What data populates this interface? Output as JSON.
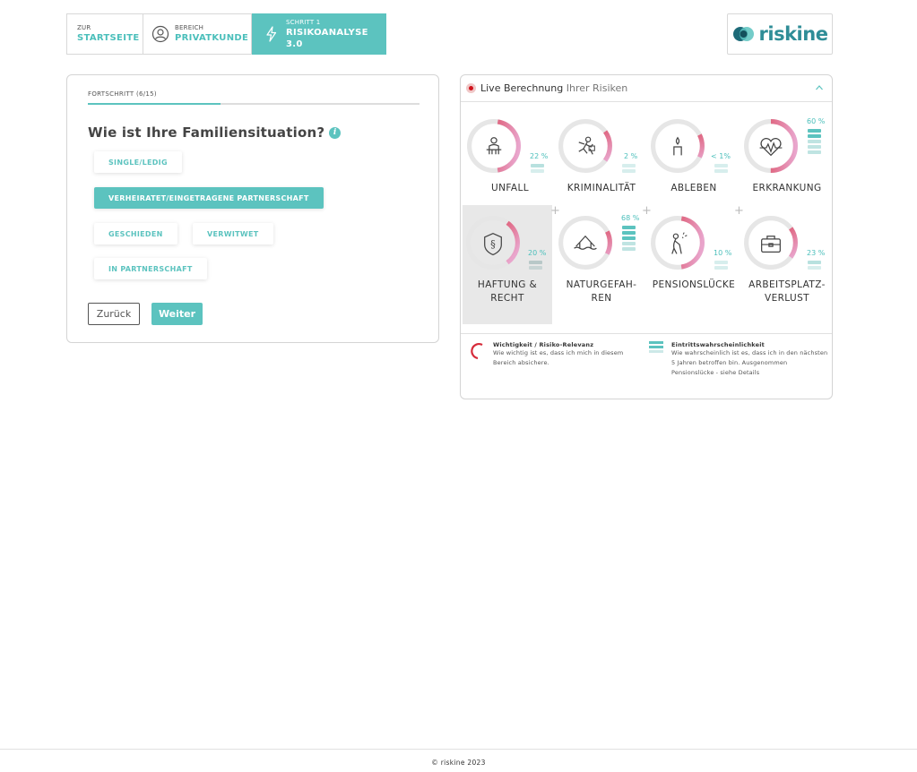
{
  "nav": {
    "start": {
      "small": "ZUR",
      "big": "STARTSEITE"
    },
    "bereich": {
      "small": "BEREICH",
      "big": "PRIVATKUNDE",
      "icon": "user-circle-icon"
    },
    "schritt": {
      "small": "SCHRITT 1",
      "big": "RISIKOANALYSE 3.0",
      "icon": "lightning-icon"
    }
  },
  "logo": {
    "text": "riskine"
  },
  "form": {
    "progress_label": "FORTSCHRITT  (6/15)",
    "progress_value": 0.4,
    "question": "Wie ist Ihre Familiensituation?",
    "info_icon": "i",
    "options": [
      {
        "label": "SINGLE/LEDIG",
        "selected": false
      },
      {
        "label": "VERHEIRATET/EINGETRAGENE PARTNERSCHAFT",
        "selected": true
      },
      {
        "label": "GESCHIEDEN",
        "selected": false
      },
      {
        "label": "VERWITWET",
        "selected": false
      },
      {
        "label": "IN PARTNERSCHAFT",
        "selected": false
      }
    ],
    "back_label": "Zurück",
    "next_label": "Weiter"
  },
  "live": {
    "title_strong": "Live Berechnung",
    "title_light": "Ihrer Risiken",
    "risks": [
      {
        "label": "UNFALL",
        "pct": "22 %",
        "icon": "injured-person-icon",
        "relevance": 0.45,
        "bars_filled": 2
      },
      {
        "label": "KRIMINALITÄT",
        "pct": "2 %",
        "icon": "thief-icon",
        "relevance": 0.2,
        "bars_filled": 0
      },
      {
        "label": "ABLEBEN",
        "pct": "< 1%",
        "icon": "candle-icon",
        "relevance": 0.15,
        "bars_filled": 0
      },
      {
        "label": "ERKRANKUNG",
        "pct": "60 %",
        "icon": "heart-pulse-icon",
        "relevance": 0.5,
        "bars_filled": 3
      },
      {
        "label": "HAFTUNG & RECHT",
        "pct": "20 %",
        "icon": "law-shield-icon",
        "relevance": 0.3,
        "bars_filled": 2
      },
      {
        "label": "NATURGEFAH-REN",
        "pct": "68 %",
        "icon": "flood-house-icon",
        "relevance": 0.15,
        "bars_filled": 4
      },
      {
        "label": "PENSIONSLÜCKE",
        "pct": "10 %",
        "icon": "elderly-person-icon",
        "relevance": 0.45,
        "bars_filled": 0
      },
      {
        "label": "ARBEITSPLATZ-VERLUST",
        "pct": "23 %",
        "icon": "briefcase-icon",
        "relevance": 0.2,
        "bars_filled": 1
      }
    ],
    "legend": {
      "relevance_title": "Wichtigkeit / Risiko-Relevanz",
      "relevance_desc": "Wie wichtig ist es, dass ich mich in diesem Bereich absichere.",
      "probability_title": "Eintrittswahrscheinlichkeit",
      "probability_desc": "Wie wahrscheinlich ist es, dass ich in den nächsten 5 Jahren betroffen bin. Ausgenommen Pensionslücke - siehe Details"
    }
  },
  "footer": {
    "copyright": "© riskine 2023"
  },
  "colors": {
    "accent": "#5cc3bf",
    "risk_red": "#d62b3a",
    "risk_pink": "#e8a3c3",
    "ring_gray": "#e6e6e6"
  }
}
